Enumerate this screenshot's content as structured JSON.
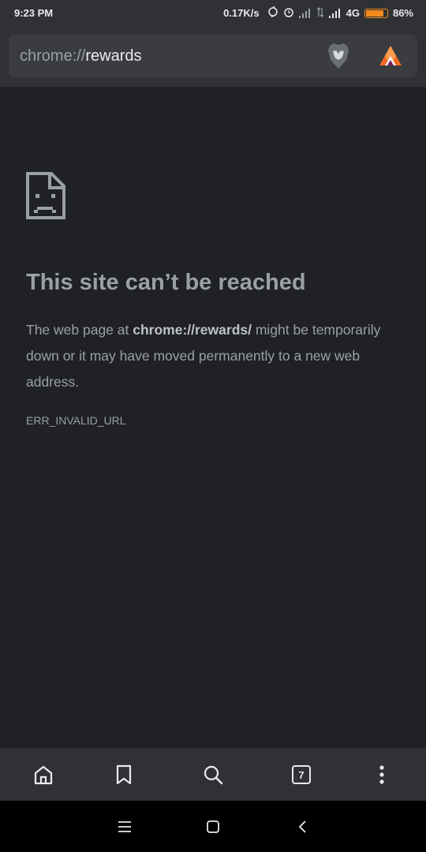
{
  "status_bar": {
    "time": "9:23 PM",
    "speed": "0.17K/s",
    "network": "4G",
    "battery": "86%",
    "battery_level": 0.86
  },
  "toolbar": {
    "url_scheme": "chrome://",
    "url_host": "rewards",
    "brave_icon": "brave-lion-icon",
    "rewards_icon": "bat-rewards-icon"
  },
  "error_page": {
    "icon": "sad-page-icon",
    "headline": "This site can’t be reached",
    "body_prefix": "The web page at ",
    "body_url": "chrome://rewards/",
    "body_suffix": " might be temporarily down or it may have moved permanently to a new web address.",
    "error_code": "ERR_INVALID_URL"
  },
  "bottom_toolbar": {
    "tab_count": "7",
    "icons": [
      "home-icon",
      "bookmark-icon",
      "search-icon",
      "tab-switcher-icon",
      "more-menu-icon"
    ]
  },
  "nav_bar": {
    "icons": [
      "menu-icon",
      "home-square-icon",
      "back-icon"
    ]
  },
  "colors": {
    "background": "#202124",
    "toolbar": "#2f3134",
    "text": "#9aa0a6",
    "battery": "#f28b1e",
    "brave_orange": "#f26722"
  }
}
